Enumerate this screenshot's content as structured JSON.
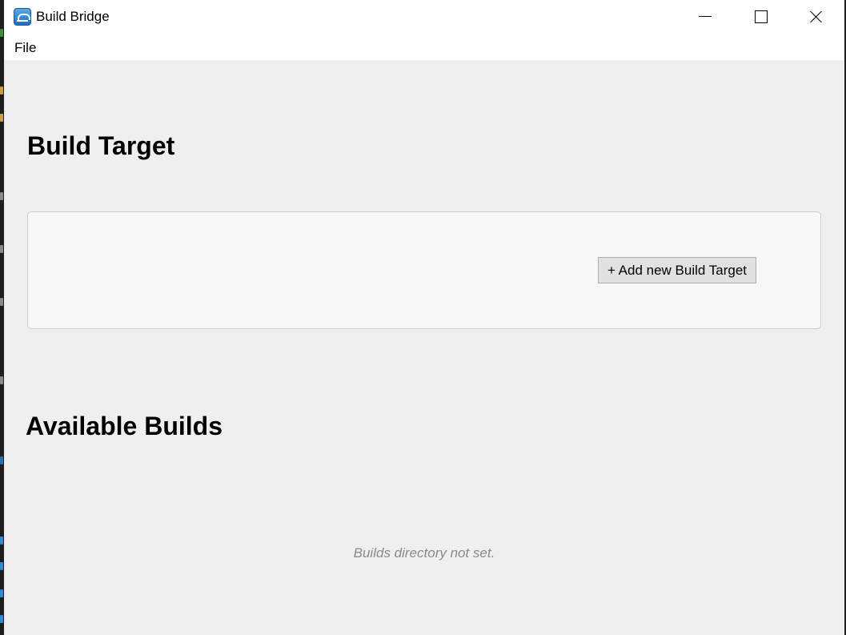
{
  "window": {
    "title": "Build Bridge",
    "icon": "build-bridge-app-icon"
  },
  "title_buttons": [
    "minimize-icon",
    "maximize-icon",
    "close-icon"
  ],
  "menu": {
    "items": [
      {
        "label": "File"
      }
    ]
  },
  "build_target": {
    "heading": "Build Target",
    "add_button_label": "+ Add new Build Target"
  },
  "available_builds": {
    "heading": "Available Builds",
    "empty_message": "Builds directory not set."
  },
  "colors": {
    "content_background": "#efefef",
    "panel_background": "#f8f8f8",
    "button_background": "#e1e1e1",
    "muted_text": "#8a8a8a"
  }
}
